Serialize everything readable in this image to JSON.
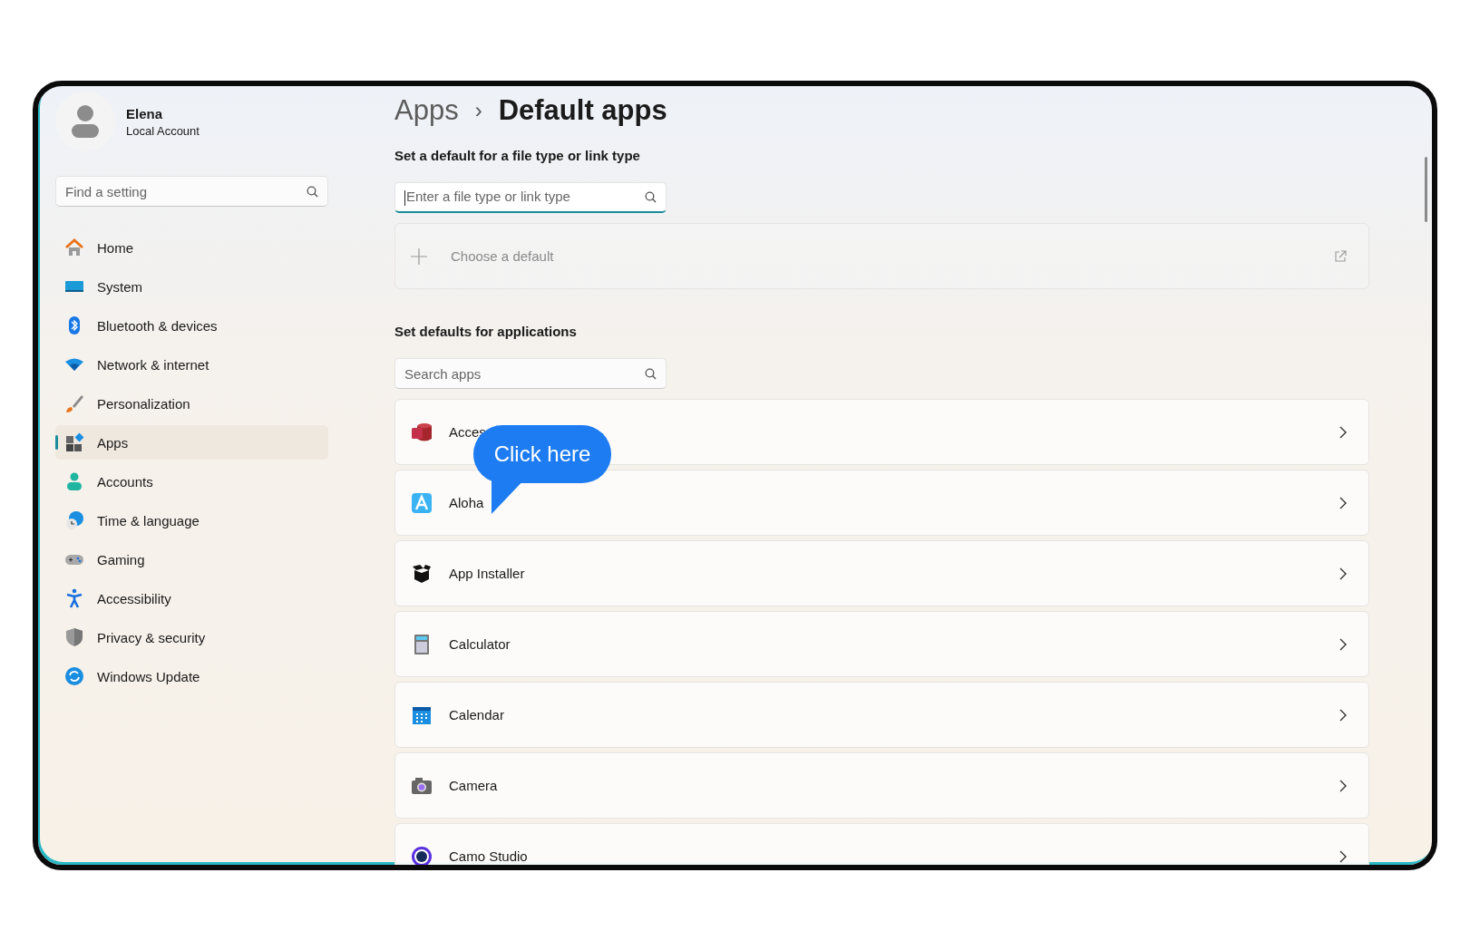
{
  "user": {
    "name": "Elena",
    "account": "Local Account"
  },
  "sidebar": {
    "search": {
      "placeholder": "Find a setting"
    },
    "items": [
      {
        "label": "Home",
        "selected": false
      },
      {
        "label": "System",
        "selected": false
      },
      {
        "label": "Bluetooth & devices",
        "selected": false
      },
      {
        "label": "Network & internet",
        "selected": false
      },
      {
        "label": "Personalization",
        "selected": false
      },
      {
        "label": "Apps",
        "selected": true
      },
      {
        "label": "Accounts",
        "selected": false
      },
      {
        "label": "Time & language",
        "selected": false
      },
      {
        "label": "Gaming",
        "selected": false
      },
      {
        "label": "Accessibility",
        "selected": false
      },
      {
        "label": "Privacy & security",
        "selected": false
      },
      {
        "label": "Windows Update",
        "selected": false
      }
    ]
  },
  "breadcrumb": {
    "parent": "Apps",
    "separator": "›",
    "current": "Default apps"
  },
  "file_type_section": {
    "heading": "Set a default for a file type or link type",
    "search": {
      "placeholder": "Enter a file type or link type",
      "focused": true
    },
    "choose": {
      "label": "Choose a default",
      "disabled": true
    }
  },
  "apps_section": {
    "heading": "Set defaults for applications",
    "search": {
      "placeholder": "Search apps"
    },
    "apps": [
      {
        "name": "Acces"
      },
      {
        "name": "Aloha"
      },
      {
        "name": "App Installer"
      },
      {
        "name": "Calculator"
      },
      {
        "name": "Calendar"
      },
      {
        "name": "Camera"
      },
      {
        "name": "Camo Studio"
      }
    ]
  },
  "callout": {
    "text": "Click here"
  }
}
